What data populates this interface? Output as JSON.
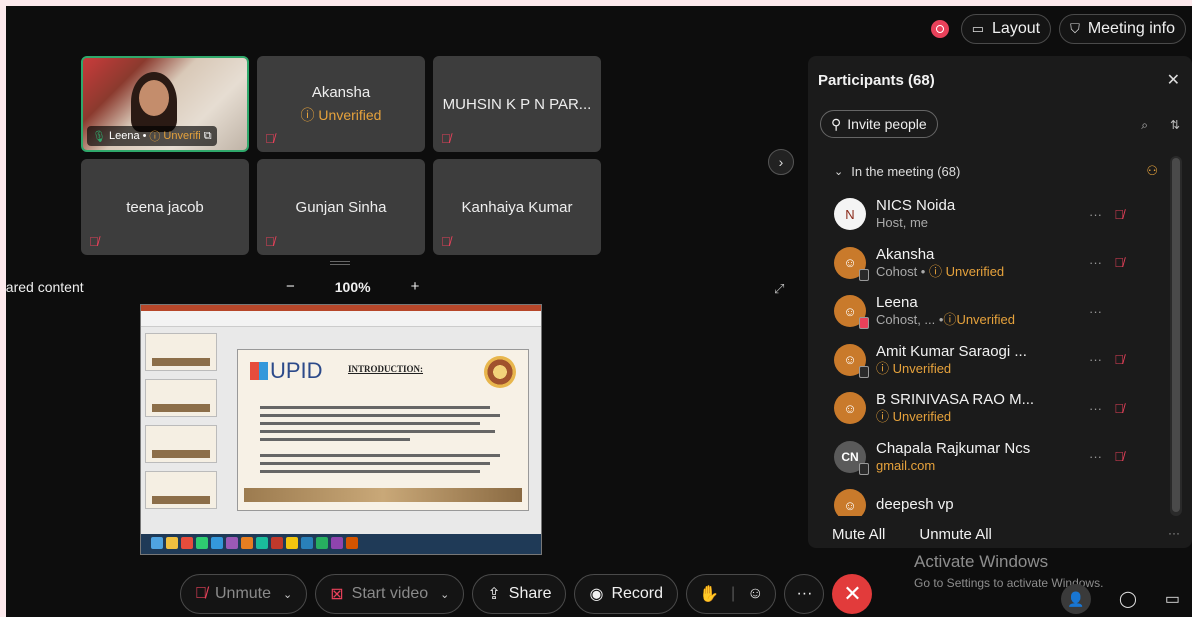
{
  "topbar": {
    "layout_label": "Layout",
    "meeting_info_label": "Meeting info",
    "layout_icon": "layout-icon",
    "info_icon": "shield-icon"
  },
  "tiles": [
    {
      "name": "Akansha",
      "status": "Unverified"
    },
    {
      "name": "MUHSIN K P N PAR...",
      "status": ""
    },
    {
      "name": "teena jacob",
      "status": ""
    },
    {
      "name": "Gunjan Sinha",
      "status": ""
    },
    {
      "name": "Kanhaiya Kumar",
      "status": ""
    }
  ],
  "active_speaker": {
    "name": "Leena",
    "status": "Unverifi"
  },
  "shared": {
    "label": "hared content",
    "zoom_minus": "−",
    "zoom": "100%",
    "zoom_plus": "+"
  },
  "slide": {
    "logo": "UPID",
    "heading": "INTRODUCTION:"
  },
  "panel": {
    "title": "Participants (68)",
    "invite_label": "Invite people",
    "section": "In the meeting (68)",
    "participants": [
      {
        "name": "NICS Noida",
        "sub": "Host, me",
        "avatar": "N",
        "unverified": ""
      },
      {
        "name": "Akansha",
        "sub": "Cohost  •",
        "avatar": "person-icon",
        "unverified": "Unverified"
      },
      {
        "name": "Leena",
        "sub": "Cohost, ...   •",
        "avatar": "person-icon",
        "unverified": "Unverified"
      },
      {
        "name": "Amit Kumar Saraogi ...",
        "sub": "",
        "avatar": "person-icon",
        "unverified": "Unverified"
      },
      {
        "name": "B SRINIVASA RAO M...",
        "sub": "",
        "avatar": "person-icon",
        "unverified": "Unverified"
      },
      {
        "name": "Chapala Rajkumar Ncs",
        "sub": "",
        "avatar": "CN",
        "email": "gmail.com"
      },
      {
        "name": "deepesh vp",
        "sub": "",
        "avatar": "person-icon",
        "unverified": ""
      }
    ],
    "mute_all": "Mute All",
    "unmute_all": "Unmute All"
  },
  "activate": {
    "line1": "Activate Windows",
    "line2": "Go to Settings to activate Windows."
  },
  "controls": {
    "unmute": "Unmute",
    "start_video": "Start video",
    "share": "Share",
    "record": "Record"
  },
  "colors": {
    "accent_warning": "#e6a23c",
    "mute_red": "#e8415a",
    "end_call": "#e23b3b",
    "active_border": "#2fa86b"
  }
}
